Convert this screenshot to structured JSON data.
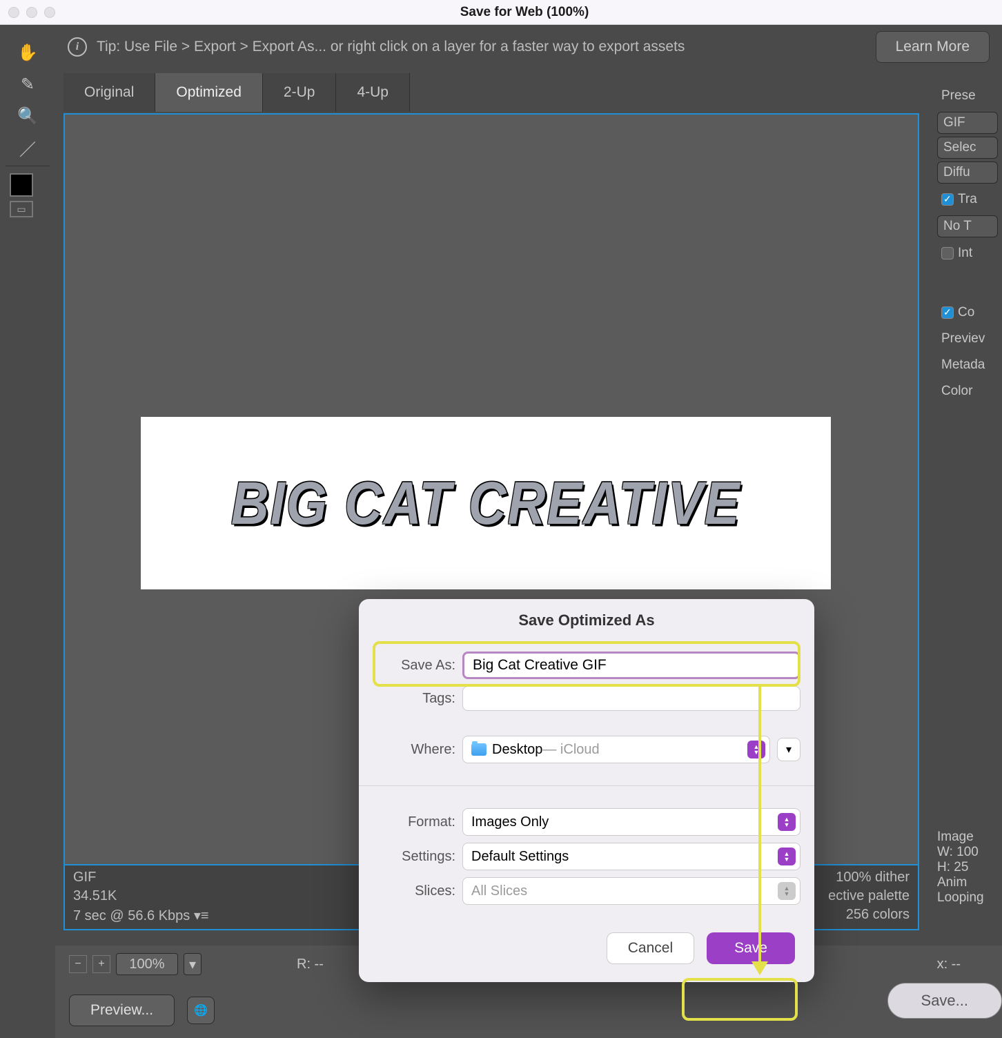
{
  "window": {
    "title": "Save for Web (100%)"
  },
  "tip": {
    "text": "Tip: Use File > Export > Export As...  or right click on a layer for a faster way to export assets",
    "learn_more": "Learn More"
  },
  "tabs": {
    "original": "Original",
    "optimized": "Optimized",
    "two_up": "2-Up",
    "four_up": "4-Up"
  },
  "logo_text": "BIG CAT CREATIVE",
  "status": {
    "format": "GIF",
    "size": "34.51K",
    "timing": "7 sec @ 56.6 Kbps  ▾≡",
    "dither": "100% dither",
    "palette": "ective palette",
    "colors": "256 colors"
  },
  "right_panel": {
    "preset": "Prese",
    "gif": "GIF",
    "selec": "Selec",
    "diffu": "Diffu",
    "tra": "Tra",
    "no_t": "No T",
    "int": "Int",
    "co": "Co",
    "preview": "Previev",
    "metadata": "Metada",
    "color": "Color",
    "image": "Image",
    "w_label": "W:",
    "w_val": "100",
    "h_label": "H:",
    "h_val": "25",
    "anim": "Anim",
    "looping": "Looping"
  },
  "bottom": {
    "zoom": "100%",
    "r_label": "R: --",
    "x_label": "x: --"
  },
  "footer": {
    "preview": "Preview...",
    "save_big": "Save..."
  },
  "modal": {
    "title": "Save Optimized As",
    "save_as_label": "Save As:",
    "save_as_value": "Big Cat Creative GIF",
    "tags_label": "Tags:",
    "where_label": "Where:",
    "where_folder": "Desktop",
    "where_cloud": " — iCloud",
    "format_label": "Format:",
    "format_value": "Images Only",
    "settings_label": "Settings:",
    "settings_value": "Default Settings",
    "slices_label": "Slices:",
    "slices_value": "All Slices",
    "cancel": "Cancel",
    "save": "Save"
  }
}
